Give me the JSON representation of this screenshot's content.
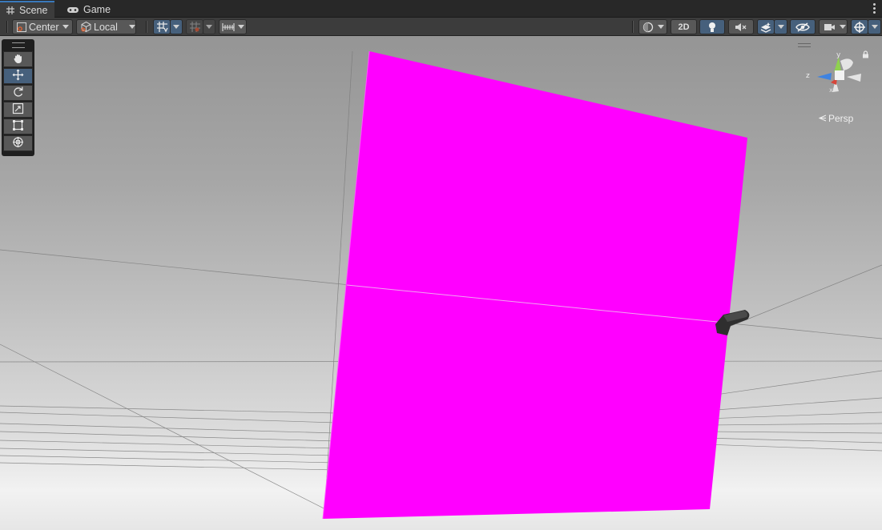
{
  "tabs": [
    {
      "label": "Scene",
      "icon": "grid-icon",
      "active": true
    },
    {
      "label": "Game",
      "icon": "gamepad-icon",
      "active": false
    }
  ],
  "toolbar": {
    "pivot_mode": "Center",
    "pivot_rotation": "Local",
    "view_2d_label": "2D"
  },
  "tools": [
    {
      "name": "hand-tool",
      "icon": "hand-icon",
      "active": false
    },
    {
      "name": "move-tool",
      "icon": "move-icon",
      "active": true
    },
    {
      "name": "rotate-tool",
      "icon": "rotate-icon",
      "active": false
    },
    {
      "name": "scale-tool",
      "icon": "scale-icon",
      "active": false
    },
    {
      "name": "rect-tool",
      "icon": "rect-icon",
      "active": false
    },
    {
      "name": "transform-tool",
      "icon": "transform-icon",
      "active": false
    }
  ],
  "gizmo": {
    "projection_label": "Persp",
    "axis_y": "y",
    "axis_z": "z",
    "axis_x": "x"
  },
  "scene": {
    "plane_color": "#ff00ff",
    "sky_color": "#9a9a9a",
    "accent": "#46607c"
  }
}
